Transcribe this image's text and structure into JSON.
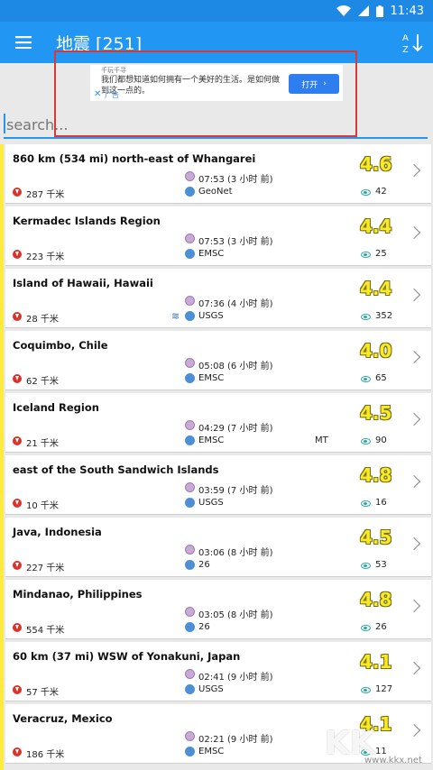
{
  "status": {
    "time": "11:43"
  },
  "appbar": {
    "title": "地震 [251]",
    "sort_label": "A Z"
  },
  "ad": {
    "brand": "千玩千寻",
    "text": "我们都想知道如何拥有一个美好的生活。是如何做到这一点的。",
    "label": "广告",
    "close": "✕",
    "button": "打开"
  },
  "search": {
    "placeholder": "search..."
  },
  "earthquakes": [
    {
      "place": "860 km (534 mi) north-east of Whangarei",
      "time": "07:53 (3 小时 前)",
      "source": "GeoNet",
      "depth": "287 千米",
      "magnitude": "4.6",
      "views": "42"
    },
    {
      "place": "Kermadec Islands Region",
      "time": "07:53 (3 小时 前)",
      "source": "EMSC",
      "depth": "223 千米",
      "magnitude": "4.4",
      "views": "25"
    },
    {
      "place": "Island of Hawaii, Hawaii",
      "time": "07:36 (4 小时 前)",
      "source": "USGS",
      "depth": "28 千米",
      "magnitude": "4.4",
      "views": "352",
      "tsunami": "≋"
    },
    {
      "place": "Coquimbo, Chile",
      "time": "05:08 (6 小时 前)",
      "source": "EMSC",
      "depth": "62 千米",
      "magnitude": "4.0",
      "views": "65"
    },
    {
      "place": "Iceland Region",
      "time": "04:29 (7 小时 前)",
      "source": "EMSC",
      "depth": "21 千米",
      "magnitude": "4.5",
      "views": "90",
      "extra": "MT"
    },
    {
      "place": "east of the South Sandwich Islands",
      "time": "03:59 (7 小时 前)",
      "source": "USGS",
      "depth": "10 千米",
      "magnitude": "4.8",
      "views": "16"
    },
    {
      "place": "Java, Indonesia",
      "time": "03:06 (8 小时 前)",
      "source": "26",
      "depth": "227 千米",
      "magnitude": "4.5",
      "views": "53"
    },
    {
      "place": "Mindanao, Philippines",
      "time": "03:05 (8 小时 前)",
      "source": "26",
      "depth": "554 千米",
      "magnitude": "4.8",
      "views": "26"
    },
    {
      "place": "60 km (37 mi) WSW of Yonakuni, Japan",
      "time": "02:41 (9 小时 前)",
      "source": "USGS",
      "depth": "57 千米",
      "magnitude": "4.1",
      "views": "127"
    },
    {
      "place": "Veracruz, Mexico",
      "time": "02:21 (9 小时 前)",
      "source": "EMSC",
      "depth": "186 千米",
      "magnitude": "4.1",
      "views": "11"
    }
  ],
  "watermark": {
    "logo": "KK",
    "site": "www.kkx.net"
  }
}
